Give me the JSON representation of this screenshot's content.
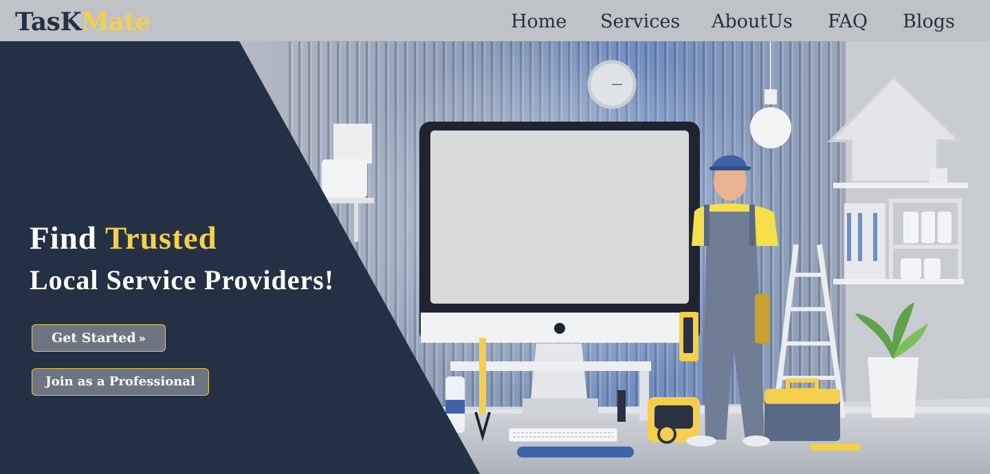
{
  "brand": {
    "part1": "TasK",
    "part2": "Mate"
  },
  "nav": {
    "items": [
      {
        "label": "Home"
      },
      {
        "label": "Services"
      },
      {
        "label": "AboutUs"
      },
      {
        "label": "FAQ"
      },
      {
        "label": "Blogs"
      }
    ]
  },
  "hero": {
    "headline_prefix": "Find",
    "headline_accent": "Trusted",
    "subline": "Local Service Providers!",
    "cta_primary": "Get Started",
    "cta_primary_icon": "»",
    "cta_secondary": "Join as a Professional"
  },
  "colors": {
    "navy": "#243044",
    "accent_yellow": "#f5cf4c",
    "nav_bg": "#bfc2c6",
    "button_bg": "#6e7582"
  },
  "icons": {
    "arrow": "double-arrow-right-icon"
  }
}
